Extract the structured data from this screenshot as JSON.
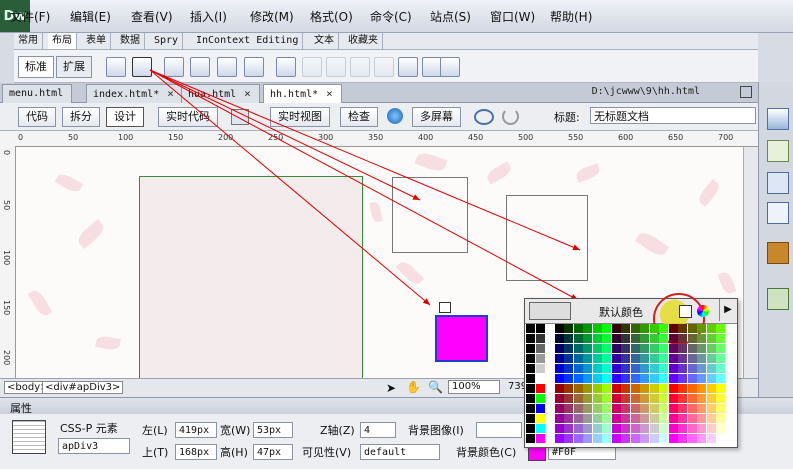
{
  "app": {
    "logo": "Dw"
  },
  "menu": [
    "文件(F)",
    "编辑(E)",
    "查看(V)",
    "插入(I)",
    "修改(M)",
    "格式(O)",
    "命令(C)",
    "站点(S)",
    "窗口(W)",
    "帮助(H)"
  ],
  "insert_tabs": [
    "常用",
    "布局",
    "表单",
    "数据",
    "Spry",
    "InContext Editing",
    "文本",
    "收藏夹"
  ],
  "insert_active": "布局",
  "layout_modes": {
    "standard": "标准",
    "expanded": "扩展"
  },
  "doc_tabs": [
    {
      "label": "menu.html",
      "closable": false
    },
    {
      "label": "index.html*",
      "closable": true
    },
    {
      "label": "hua.html",
      "closable": true
    },
    {
      "label": "hh.html*",
      "closable": true
    }
  ],
  "doc_path": "D:\\jcwww\\9\\hh.html",
  "doc_toolbar": {
    "code": "代码",
    "split": "拆分",
    "design": "设计",
    "live_code": "实时代码",
    "live_view": "实时视图",
    "inspect": "检查",
    "multiscreen": "多屏幕",
    "title_label": "标题:",
    "title_value": "无标题文档"
  },
  "ruler_h_ticks": [
    "0",
    "50",
    "100",
    "150",
    "200",
    "250",
    "300",
    "350",
    "400",
    "450",
    "500",
    "550",
    "600",
    "650",
    "700"
  ],
  "ruler_v_ticks": [
    "0",
    "50",
    "100",
    "150",
    "200"
  ],
  "status": {
    "tag_body": "<body>",
    "tag_div": "<div#apDiv3>",
    "zoom": "100%",
    "size": "739"
  },
  "properties": {
    "header": "属性",
    "element_type": "CSS-P 元素",
    "element_id": "apDiv3",
    "left_label": "左(L)",
    "left_value": "419px",
    "top_label": "上(T)",
    "top_value": "168px",
    "width_label": "宽(W)",
    "width_value": "53px",
    "height_label": "高(H)",
    "height_value": "47px",
    "z_label": "Z轴(Z)",
    "z_value": "4",
    "visibility_label": "可见性(V)",
    "visibility_value": "default",
    "bgimage_label": "背景图像(I)",
    "bgcolor_label": "背景颜色(C)",
    "bgcolor_value": "#F0F"
  },
  "palette": {
    "default_label": "默认颜色"
  },
  "colors": {
    "magenta": "#ff00ff",
    "arrow_red": "#e00000",
    "ui_blue": "#3366cc"
  }
}
